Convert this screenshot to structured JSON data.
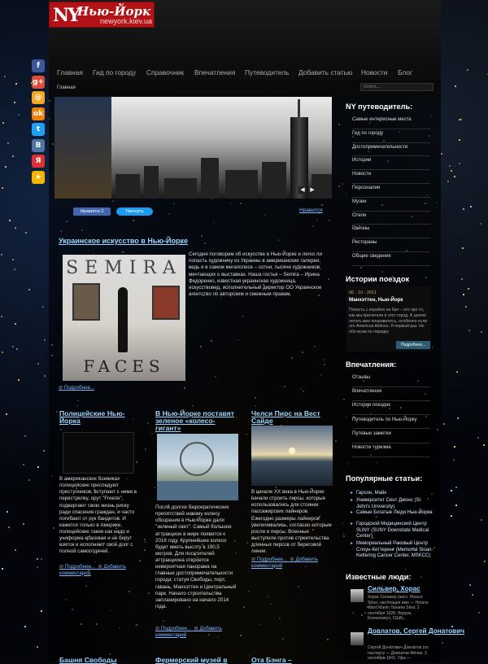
{
  "brand": {
    "mark": "NY",
    "name": "Нью-Йорк",
    "domain": "newyork.kiev.ua"
  },
  "nav": [
    "Главная",
    "Гид по городу",
    "Справочник",
    "Впечатления",
    "Путеводитель",
    "Добавить статью",
    "Новости",
    "Блог"
  ],
  "breadcrumb": "Главная",
  "search": {
    "placeholder": "поиск..."
  },
  "share_icons": [
    {
      "name": "facebook-icon",
      "glyph": "f",
      "color": "#3b5998"
    },
    {
      "name": "google-plus-icon",
      "glyph": "g+",
      "color": "#dd4b39"
    },
    {
      "name": "mail-icon",
      "glyph": "@",
      "color": "#f5a623"
    },
    {
      "name": "odnoklassniki-icon",
      "glyph": "ok",
      "color": "#ee8208"
    },
    {
      "name": "twitter-icon",
      "glyph": "t",
      "color": "#1da1f2"
    },
    {
      "name": "vkontakte-icon",
      "glyph": "B",
      "color": "#4c75a3"
    },
    {
      "name": "yandex-icon",
      "glyph": "Я",
      "color": "#e03030"
    },
    {
      "name": "bookmark-star-icon",
      "glyph": "★",
      "color": "#f7b500"
    }
  ],
  "social": {
    "like": "Нравится 2",
    "tweet": "Твитнуть",
    "like_link": "Нравится"
  },
  "featured": {
    "title": "Украинское искусство в Нью-Йорке",
    "image_top": "SEMIRA",
    "image_bottom": "FACES",
    "text": "Сегодня поговорим об искусстве в Нью-Йорке и легко ли попасть художнику из Украины в американские галереи, ведь и в самом мегаполисе – сотни, тысячи художников, мечтающих о выставках. Наша гостья – Semira – Ирина Федоренко, известная украинская художница, искусствовед, исполнительный директор ОО Украинское агентство по авторским и смежным правам.",
    "more": "Подробнее..."
  },
  "columns": [
    {
      "title": "Полицейские Нью-Йорка",
      "text": "В американских боевиках полицейские преследуют преступников, вступают с ними в перестрелку, орут \"Freeze\", подвергают свою жизнь риску ради спасения граждан, и часто погибают от рук бандитов. И кажется только в Америке, полицейские такие как надо и униформа красивая и не берут взяток и исполняют свой долг с полной самоотдачей.",
      "more": "Подробнее...",
      "comment": "Добавить комментарий"
    },
    {
      "title": "В Нью-Йорке поставят зеленое «колесо-гигант»",
      "text": "После долгих бюрократических препятствий новому колесу обозрения в Нью-Йорке дали \"зеленый свет\". Самый большое аттракцион в мире появится к 2016 году. Крупнейшее колесо будет иметь высоту в 190,5 метров. Для посетителей аттракциона откроется невероятная панорама на главные достопримечательности города: статуя Свободы, порт, гавань, Манхэттен и Центральный парк. Начало строительства запланировано на начало 2014 года.",
      "more": "Подробнее...",
      "comment": "Добавить комментарий"
    },
    {
      "title": "Челси Пирс на Вест Сайде",
      "text": "В начале ХХ века в Нью-Йорке начали строить пирсы, которые использовались для стоянки пассажирских лайнеров. Ежегодно размеры лайнеров увеличивались, согласно которым росли и пирсы. Военные выступили против строительства длинных пирсов от береговой линии.",
      "more": "Подробнее...",
      "comment": "Добавить комментарий"
    }
  ],
  "bottom_titles": [
    "Башня Свободы",
    "Фермерский музей в",
    "Ота Бэнга –"
  ],
  "sidebar": {
    "guide_title": "NY путеводитель:",
    "guide_items": [
      "Самые интересные места",
      "Гид по городу",
      "Достопримечательности",
      "Истории",
      "Новости",
      "Персоналии",
      "Музеи",
      "Отели",
      "Районы",
      "Рестораны",
      "Общие сведения"
    ],
    "stories_title": "Истории поездок",
    "story": {
      "date": "06 - 10 - 2011",
      "title": "Манхэттен, Нью-Йорк",
      "text": "Попасть с корабля на бал – это про то, как мы прилетели в этот город. А целом летать мне понравилось, особенно если это American Airlines. Я первый раз. Но обо всем по порядку",
      "button": "Подробнее..."
    },
    "impressions_title": "Впечатления:",
    "impressions_items": [
      "Отзывы",
      "Впечатления",
      "Истории поездок",
      "Путеводитель по Нью-Йорку",
      "Путевые заметки",
      "Новости туризма"
    ],
    "popular_title": "Популярные статьи:",
    "popular_items": [
      "Гарсон, Майк",
      "Университет Сент Джонс (St. John's University)",
      "Самые Богатые Люди Нью-Йорка",
      "Городской Медицинский Центр SUNY (SUNY Downstate Medical Center)",
      "Мемориальный Раковый Центр Слоун-Кеттеринг (Memorial Sloan-Kettering Cancer Center, MSKCC)"
    ],
    "people_title": "Известные люди:",
    "people": [
      {
        "name": "Сильвер, Хорас",
        "text": "Хорас Сильвер (англ. Horace Silver, настоящее имя — Horace Ward Martin Tavares Silva; 2 сентября 1928, Норуок, Коннектикут, США)..."
      },
      {
        "name": "Довлатов, Сергей Донатович",
        "text": "Серге́й Дона́тович Довла́тов (по паспорту — Довлатов-Ме́чик; 3 сентября 1941, Уфа —"
      }
    ]
  }
}
